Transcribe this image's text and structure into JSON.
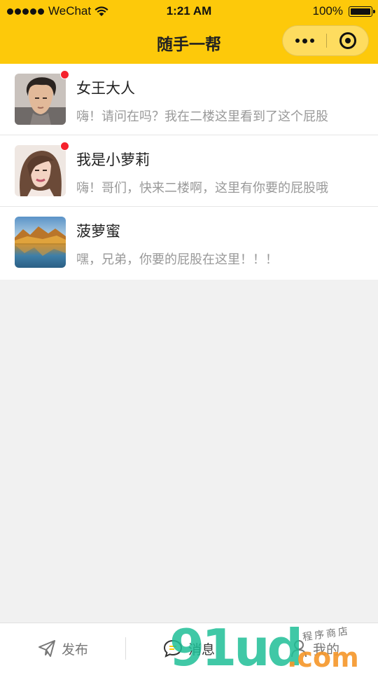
{
  "status_bar": {
    "carrier": "WeChat",
    "time": "1:21 AM",
    "battery": "100%"
  },
  "nav": {
    "title": "随手一帮"
  },
  "messages": [
    {
      "name": "女王大人",
      "preview": "嗨！请问在吗？我在二楼这里看到了这个屁股",
      "unread": true,
      "avatar": "man-portrait-avatar"
    },
    {
      "name": "我是小萝莉",
      "preview": "嗨！哥们，快来二楼啊，这里有你要的屁股哦",
      "unread": true,
      "avatar": "woman-portrait-avatar"
    },
    {
      "name": "菠萝蜜",
      "preview": "嘿，兄弟，你要的屁股在这里！！！",
      "unread": false,
      "avatar": "lake-landscape-avatar"
    }
  ],
  "tabbar": {
    "publish": "发布",
    "message": "消息",
    "mine": "我的"
  },
  "watermark": {
    "main": "91ud",
    "suffix": ".com",
    "store": "程序商店"
  },
  "colors": {
    "brand_yellow": "#fdc90a",
    "unread_red": "#f5222d",
    "background": "#f1f1f1"
  }
}
